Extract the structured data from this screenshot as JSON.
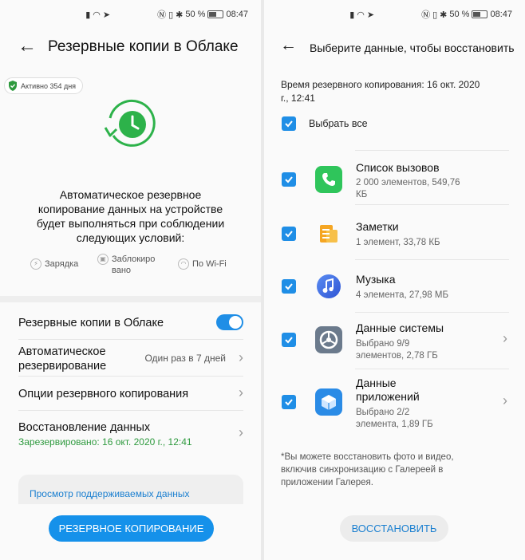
{
  "status_bar": {
    "battery": "50 %",
    "time": "08:47"
  },
  "left": {
    "title": "Резервные копии в Облаке",
    "active_badge": "Активно 354 дня",
    "description": [
      "Автоматическое резервное",
      "копирование данных на устройстве",
      "будет выполняться при соблюдении",
      "следующих условий:"
    ],
    "conditions": {
      "charging": "Зарядка",
      "locked_1": "Заблокиро",
      "locked_2": "вано",
      "wifi": "По Wi-Fi"
    },
    "rows": {
      "cloud_backup": "Резервные копии в Облаке",
      "auto_backup_1": "Автоматическое",
      "auto_backup_2": "резервирование",
      "auto_backup_value": "Один раз в 7 дней",
      "backup_options": "Опции резервного копирования",
      "restore": "Восстановление данных",
      "restore_status": "Зарезервировано: 16 окт. 2020 г., 12:41"
    },
    "supported_data_link": "Просмотр поддерживаемых данных",
    "backup_button": "РЕЗЕРВНОЕ КОПИРОВАНИЕ"
  },
  "right": {
    "title": "Выберите данные, чтобы восстановить",
    "backup_time_1": "Время резервного копирования: 16 окт. 2020",
    "backup_time_2": "г., 12:41",
    "select_all": "Выбрать все",
    "items": [
      {
        "name": "Список вызовов",
        "sub1": "2 000 элементов, 549,76",
        "sub2": "КБ",
        "icon": "phone-icon"
      },
      {
        "name": "Заметки",
        "sub1": "1 элемент, 33,78 КБ",
        "icon": "notes-icon"
      },
      {
        "name": "Музыка",
        "sub1": "4 элемента, 27,98 МБ",
        "icon": "music-icon"
      },
      {
        "name": "Данные системы",
        "sub1": "Выбрано 9/9",
        "sub2": "элементов, 2,78 ГБ",
        "icon": "settings-icon"
      },
      {
        "name": "Данные",
        "name2": "приложений",
        "sub1": "Выбрано 2/2",
        "sub2": "элемента, 1,89 ГБ",
        "icon": "app-data-icon"
      }
    ],
    "note": [
      "*Вы можете восстановить фото и видео,",
      "включив синхронизацию с Галереей в",
      "приложении Галерея."
    ],
    "restore_button": "ВОССТАНОВИТЬ"
  },
  "colors": {
    "accent": "#1f8ee6",
    "green": "#2e9a3e",
    "phone": "#2fc55b",
    "notes": "#f5a623",
    "music": "#3a6fe0",
    "system": "#5f6e7f",
    "apps": "#2a8be6"
  }
}
